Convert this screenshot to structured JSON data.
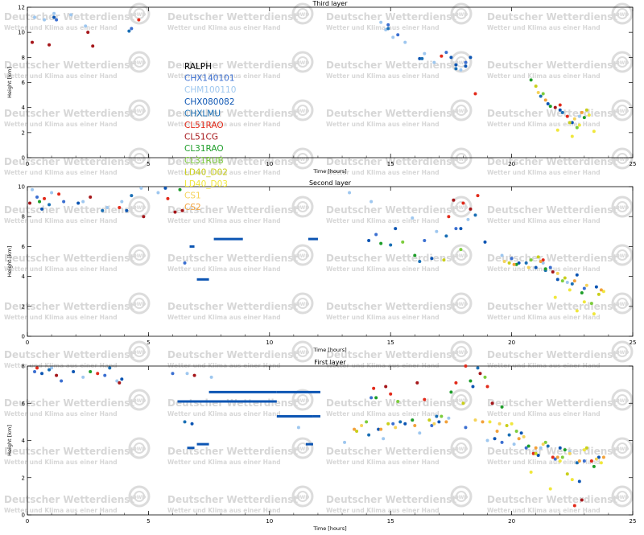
{
  "watermark": {
    "line1": "Deutscher Wetterdienst",
    "line2": "Wetter und Klima aus einer Hand",
    "logo": "DWD"
  },
  "legend": [
    {
      "name": "RALPH",
      "color": "#000000"
    },
    {
      "name": "CHX140101",
      "color": "#3b6fd1"
    },
    {
      "name": "CHM100110",
      "color": "#9ec7ef"
    },
    {
      "name": "CHX080082",
      "color": "#0c55b3"
    },
    {
      "name": "CHXLMU",
      "color": "#1a6fb5"
    },
    {
      "name": "CL51RAO",
      "color": "#e22a1a"
    },
    {
      "name": "CL51CG",
      "color": "#a5161a"
    },
    {
      "name": "CL31RAO",
      "color": "#1e9e2a"
    },
    {
      "name": "CL31RUB",
      "color": "#7ccc3c"
    },
    {
      "name": "LD40_D02",
      "color": "#c9cf1a"
    },
    {
      "name": "LD40_D03",
      "color": "#f0e73c"
    },
    {
      "name": "CS1",
      "color": "#f5d35a"
    },
    {
      "name": "CS2",
      "color": "#f2a13a"
    }
  ],
  "chart_data": [
    {
      "type": "scatter",
      "title": "Third layer",
      "xlabel": "Time [hours]",
      "ylabel": "Height [km]",
      "xlim": [
        0,
        25
      ],
      "ylim": [
        0,
        12
      ],
      "xticks": [
        "0",
        "5",
        "10",
        "15",
        "20",
        "25"
      ],
      "yticks": [
        "0",
        "2",
        "4",
        "6",
        "8",
        "10",
        "12"
      ],
      "series": [
        {
          "name": "RALPH",
          "x": [],
          "y": []
        },
        {
          "name": "CHX140101",
          "x": [
            1.2,
            4.3,
            14.9,
            15.3,
            17.3,
            18.1
          ],
          "y": [
            11.0,
            10.3,
            10.6,
            9.8,
            8.4,
            7.6
          ]
        },
        {
          "name": "CHM100110",
          "x": [
            0.3,
            0.7,
            1.1,
            1.8,
            2.4,
            14.6,
            14.8,
            15.1,
            15.6,
            16.4,
            16.8,
            17.9,
            22.8
          ],
          "y": [
            11.2,
            11.0,
            11.5,
            11.4,
            10.5,
            10.8,
            10.2,
            9.6,
            9.2,
            8.3,
            7.6,
            7.0,
            3.3
          ]
        },
        {
          "name": "CHX080082",
          "x": [
            1.1,
            16.2,
            17.5,
            17.7,
            18.1,
            18.3,
            21.5,
            22.0,
            22.5
          ],
          "y": [
            11.2,
            7.9,
            8.0,
            7.4,
            7.3,
            8.0,
            4.3,
            3.8,
            2.8
          ]
        },
        {
          "name": "CHXLMU",
          "x": [
            4.2,
            14.9,
            16.3,
            17.7,
            21.2,
            22.1
          ],
          "y": [
            10.1,
            10.3,
            7.9,
            7.1,
            4.9,
            3.6
          ]
        },
        {
          "name": "CL51RAO",
          "x": [
            4.6,
            17.1,
            18.5,
            22.0,
            22.3
          ],
          "y": [
            11.0,
            8.1,
            5.1,
            4.2,
            3.3
          ]
        },
        {
          "name": "CL51CG",
          "x": [
            0.2,
            0.9,
            2.5,
            2.7,
            21.8
          ],
          "y": [
            9.2,
            9.0,
            10.0,
            8.9,
            4.0
          ]
        },
        {
          "name": "CL31RAO",
          "x": [
            20.8,
            21.6,
            23.0
          ],
          "y": [
            6.2,
            4.1,
            3.2
          ]
        },
        {
          "name": "CL31RUB",
          "x": [
            21.3,
            22.7
          ],
          "y": [
            5.1,
            2.4
          ]
        },
        {
          "name": "LD40_D02",
          "x": [
            21.0,
            22.4,
            23.1
          ],
          "y": [
            5.7,
            2.8,
            3.8
          ]
        },
        {
          "name": "LD40_D03",
          "x": [
            21.9,
            22.5,
            22.8,
            23.2,
            23.4
          ],
          "y": [
            2.2,
            1.7,
            2.6,
            3.4,
            2.1
          ]
        },
        {
          "name": "CS1",
          "x": [
            21.1,
            22.6
          ],
          "y": [
            5.2,
            3.1
          ]
        },
        {
          "name": "CS2",
          "x": [
            21.4,
            22.9
          ],
          "y": [
            4.6,
            3.6
          ]
        }
      ]
    },
    {
      "type": "scatter",
      "title": "Second layer",
      "xlabel": "Time [hours]",
      "ylabel": "Height [km]",
      "xlim": [
        0,
        25
      ],
      "ylim": [
        0,
        10
      ],
      "xticks": [
        "0",
        "5",
        "10",
        "15",
        "20",
        "25"
      ],
      "yticks": [
        "0",
        "2",
        "4",
        "6",
        "8",
        "10"
      ],
      "segments": [
        {
          "name": "CHX080082",
          "x0": 7.7,
          "x1": 8.9,
          "y": 6.5
        },
        {
          "name": "CHX080082",
          "x0": 11.6,
          "x1": 12.0,
          "y": 6.5
        },
        {
          "name": "CHX080082",
          "x0": 7.0,
          "x1": 7.5,
          "y": 3.8
        },
        {
          "name": "CHX080082",
          "x0": 6.7,
          "x1": 6.9,
          "y": 6.0
        }
      ],
      "series": [
        {
          "name": "RALPH",
          "x": [],
          "y": []
        },
        {
          "name": "CHX140101",
          "x": [
            0.4,
            1.5,
            6.5,
            14.4,
            16.4,
            17.7,
            20.0,
            21.6,
            23.0
          ],
          "y": [
            9.3,
            9.0,
            4.9,
            6.8,
            6.4,
            7.2,
            5.2,
            4.6,
            3.2
          ]
        },
        {
          "name": "CHM100110",
          "x": [
            0.2,
            1.0,
            2.3,
            3.3,
            3.9,
            4.7,
            5.4,
            13.3,
            14.2,
            15.9,
            16.9,
            18.2,
            19.6,
            21.3,
            22.3
          ],
          "y": [
            9.8,
            9.6,
            9.0,
            8.6,
            9.0,
            9.9,
            9.6,
            9.6,
            9.0,
            7.9,
            7.0,
            7.8,
            5.4,
            4.9,
            3.6
          ]
        },
        {
          "name": "CHX080082",
          "x": [
            0.6,
            2.1,
            4.1,
            5.7,
            14.1,
            15.2,
            16.7,
            17.9,
            18.9,
            20.3,
            21.0,
            21.9,
            22.7,
            23.5
          ],
          "y": [
            8.5,
            8.9,
            8.4,
            9.9,
            6.4,
            7.2,
            5.2,
            7.2,
            6.3,
            4.9,
            4.6,
            3.8,
            4.1,
            3.3
          ]
        },
        {
          "name": "CHXLMU",
          "x": [
            0.9,
            3.1,
            4.3,
            15.0,
            16.2,
            17.3,
            18.5,
            20.6,
            21.4,
            22.5
          ],
          "y": [
            8.8,
            8.4,
            9.4,
            6.1,
            5.0,
            6.7,
            8.1,
            4.9,
            4.4,
            3.5
          ]
        },
        {
          "name": "CL51RAO",
          "x": [
            0.7,
            1.3,
            3.8,
            5.8,
            17.4,
            18.0,
            18.6,
            21.3
          ],
          "y": [
            9.2,
            9.5,
            8.6,
            9.2,
            8.0,
            8.9,
            9.4,
            5.1
          ]
        },
        {
          "name": "CL51CG",
          "x": [
            0.1,
            2.6,
            4.8,
            6.1,
            6.4,
            17.6,
            18.3,
            21.7
          ],
          "y": [
            8.9,
            9.3,
            8.0,
            8.3,
            8.4,
            9.1,
            8.5,
            4.3
          ]
        },
        {
          "name": "CL31RAO",
          "x": [
            0.5,
            6.3,
            14.6,
            16.0,
            20.2,
            21.4,
            22.9
          ],
          "y": [
            9.0,
            9.8,
            6.2,
            5.4,
            4.8,
            4.5,
            2.9
          ]
        },
        {
          "name": "CL31RUB",
          "x": [
            15.5,
            17.9,
            20.8,
            22.1,
            23.3
          ],
          "y": [
            6.3,
            5.8,
            5.1,
            3.7,
            2.2
          ]
        },
        {
          "name": "LD40_D02",
          "x": [
            17.2,
            19.9,
            21.1,
            22.2,
            23.6
          ],
          "y": [
            5.1,
            4.9,
            5.3,
            3.9,
            2.8
          ]
        },
        {
          "name": "LD40_D03",
          "x": [
            21.8,
            22.4,
            22.7,
            23.0,
            23.4,
            23.8
          ],
          "y": [
            2.6,
            3.1,
            1.7,
            2.3,
            1.5,
            3.0
          ]
        },
        {
          "name": "CS1",
          "x": [
            19.7,
            20.7,
            21.9,
            23.1
          ],
          "y": [
            5.0,
            4.6,
            4.2,
            3.4
          ]
        },
        {
          "name": "CS2",
          "x": [
            20.1,
            21.2,
            22.6,
            23.7
          ],
          "y": [
            4.8,
            5.0,
            3.7,
            3.1
          ]
        }
      ]
    },
    {
      "type": "scatter",
      "title": "First layer",
      "xlabel": "Time [hours]",
      "ylabel": "Height [km]",
      "xlim": [
        0,
        25
      ],
      "ylim": [
        0,
        8
      ],
      "xticks": [
        "0",
        "5",
        "10",
        "15",
        "20",
        "25"
      ],
      "yticks": [
        "0",
        "2",
        "4",
        "6",
        "8"
      ],
      "segments": [
        {
          "name": "CHX080082",
          "x0": 6.2,
          "x1": 10.3,
          "y": 6.1
        },
        {
          "name": "CHX080082",
          "x0": 7.5,
          "x1": 10.3,
          "y": 6.6
        },
        {
          "name": "CHX080082",
          "x0": 10.3,
          "x1": 12.1,
          "y": 6.6
        },
        {
          "name": "CHX080082",
          "x0": 10.3,
          "x1": 11.8,
          "y": 5.3
        },
        {
          "name": "CHX080082",
          "x0": 11.8,
          "x1": 12.1,
          "y": 5.3
        },
        {
          "name": "CHX080082",
          "x0": 7.0,
          "x1": 7.5,
          "y": 3.8
        },
        {
          "name": "CHX080082",
          "x0": 6.6,
          "x1": 6.9,
          "y": 3.6
        },
        {
          "name": "CHX080082",
          "x0": 11.5,
          "x1": 11.8,
          "y": 3.8
        }
      ],
      "series": [
        {
          "name": "RALPH",
          "x": [],
          "y": []
        },
        {
          "name": "CHX140101",
          "x": [
            0.3,
            1.4,
            3.2,
            6.0,
            14.2,
            15.1,
            16.7,
            18.1,
            19.6,
            20.6,
            21.8,
            23.0
          ],
          "y": [
            7.7,
            7.2,
            7.5,
            7.6,
            6.3,
            4.9,
            4.8,
            4.7,
            3.9,
            3.6,
            3.0,
            2.9
          ]
        },
        {
          "name": "CHM100110",
          "x": [
            1.0,
            2.3,
            3.7,
            6.6,
            7.6,
            11.2,
            13.1,
            14.7,
            16.2,
            17.4,
            19.0,
            20.1,
            21.2,
            22.4
          ],
          "y": [
            7.9,
            7.4,
            7.2,
            7.6,
            7.4,
            4.7,
            3.9,
            4.1,
            4.4,
            5.2,
            4.0,
            3.8,
            3.6,
            3.4
          ]
        },
        {
          "name": "CHX080082",
          "x": [
            0.6,
            1.9,
            3.9,
            6.8,
            14.5,
            15.6,
            17.0,
            18.4,
            19.3,
            20.4,
            21.1,
            22.0,
            22.8,
            23.6
          ],
          "y": [
            7.6,
            7.7,
            7.3,
            4.9,
            4.6,
            4.9,
            5.0,
            6.9,
            4.1,
            4.4,
            3.2,
            3.6,
            1.8,
            3.1
          ]
        },
        {
          "name": "CHXLMU",
          "x": [
            0.9,
            3.4,
            6.5,
            14.1,
            15.4,
            16.9,
            18.6,
            19.9,
            21.5,
            22.7
          ],
          "y": [
            7.8,
            7.9,
            5.0,
            4.3,
            5.0,
            5.3,
            7.9,
            4.3,
            3.7,
            2.8
          ]
        },
        {
          "name": "CL51RAO",
          "x": [
            0.4,
            2.9,
            14.3,
            15.0,
            16.4,
            17.7,
            18.1,
            19.0,
            20.9,
            21.7,
            22.6,
            23.3
          ],
          "y": [
            7.9,
            7.6,
            6.8,
            6.5,
            6.2,
            7.1,
            8.0,
            6.9,
            3.3,
            3.1,
            0.5,
            2.9
          ]
        },
        {
          "name": "CL51CG",
          "x": [
            1.2,
            3.8,
            6.9,
            14.8,
            16.1,
            18.7,
            19.2,
            22.9
          ],
          "y": [
            7.5,
            7.1,
            7.5,
            6.9,
            7.1,
            7.6,
            6.0,
            0.8
          ]
        },
        {
          "name": "CL31RAO",
          "x": [
            2.6,
            14.4,
            15.9,
            17.5,
            18.3,
            19.6,
            20.7,
            22.2,
            23.4
          ],
          "y": [
            7.7,
            6.3,
            5.1,
            6.6,
            7.2,
            5.8,
            3.7,
            3.5,
            2.6
          ]
        },
        {
          "name": "CL31RUB",
          "x": [
            14.0,
            15.3,
            17.1,
            18.9,
            20.2,
            21.4,
            22.1
          ],
          "y": [
            5.0,
            6.1,
            5.3,
            7.4,
            4.5,
            3.9,
            3.1
          ]
        },
        {
          "name": "LD40_D02",
          "x": [
            13.6,
            14.9,
            16.6,
            18.0,
            19.8,
            21.0,
            22.3,
            23.1
          ],
          "y": [
            4.5,
            4.9,
            5.1,
            6.0,
            4.8,
            3.3,
            2.2,
            3.6
          ]
        },
        {
          "name": "LD40_D03",
          "x": [
            19.1,
            20.0,
            20.8,
            21.6,
            22.0,
            22.5,
            23.0,
            23.7
          ],
          "y": [
            5.0,
            4.9,
            2.3,
            1.4,
            2.9,
            1.9,
            3.5,
            2.8
          ]
        },
        {
          "name": "CS1",
          "x": [
            13.8,
            15.2,
            16.8,
            18.5,
            19.5,
            20.5,
            21.3,
            22.4,
            23.5
          ],
          "y": [
            4.8,
            4.7,
            4.9,
            5.1,
            4.9,
            4.2,
            3.8,
            3.3,
            3.0
          ]
        },
        {
          "name": "CS2",
          "x": [
            13.5,
            14.6,
            16.0,
            17.3,
            18.8,
            19.4,
            20.3,
            21.0,
            21.9,
            22.8,
            23.8
          ],
          "y": [
            4.6,
            4.6,
            4.8,
            5.0,
            5.0,
            4.5,
            4.1,
            3.6,
            3.1,
            2.9,
            3.1
          ]
        }
      ]
    }
  ]
}
